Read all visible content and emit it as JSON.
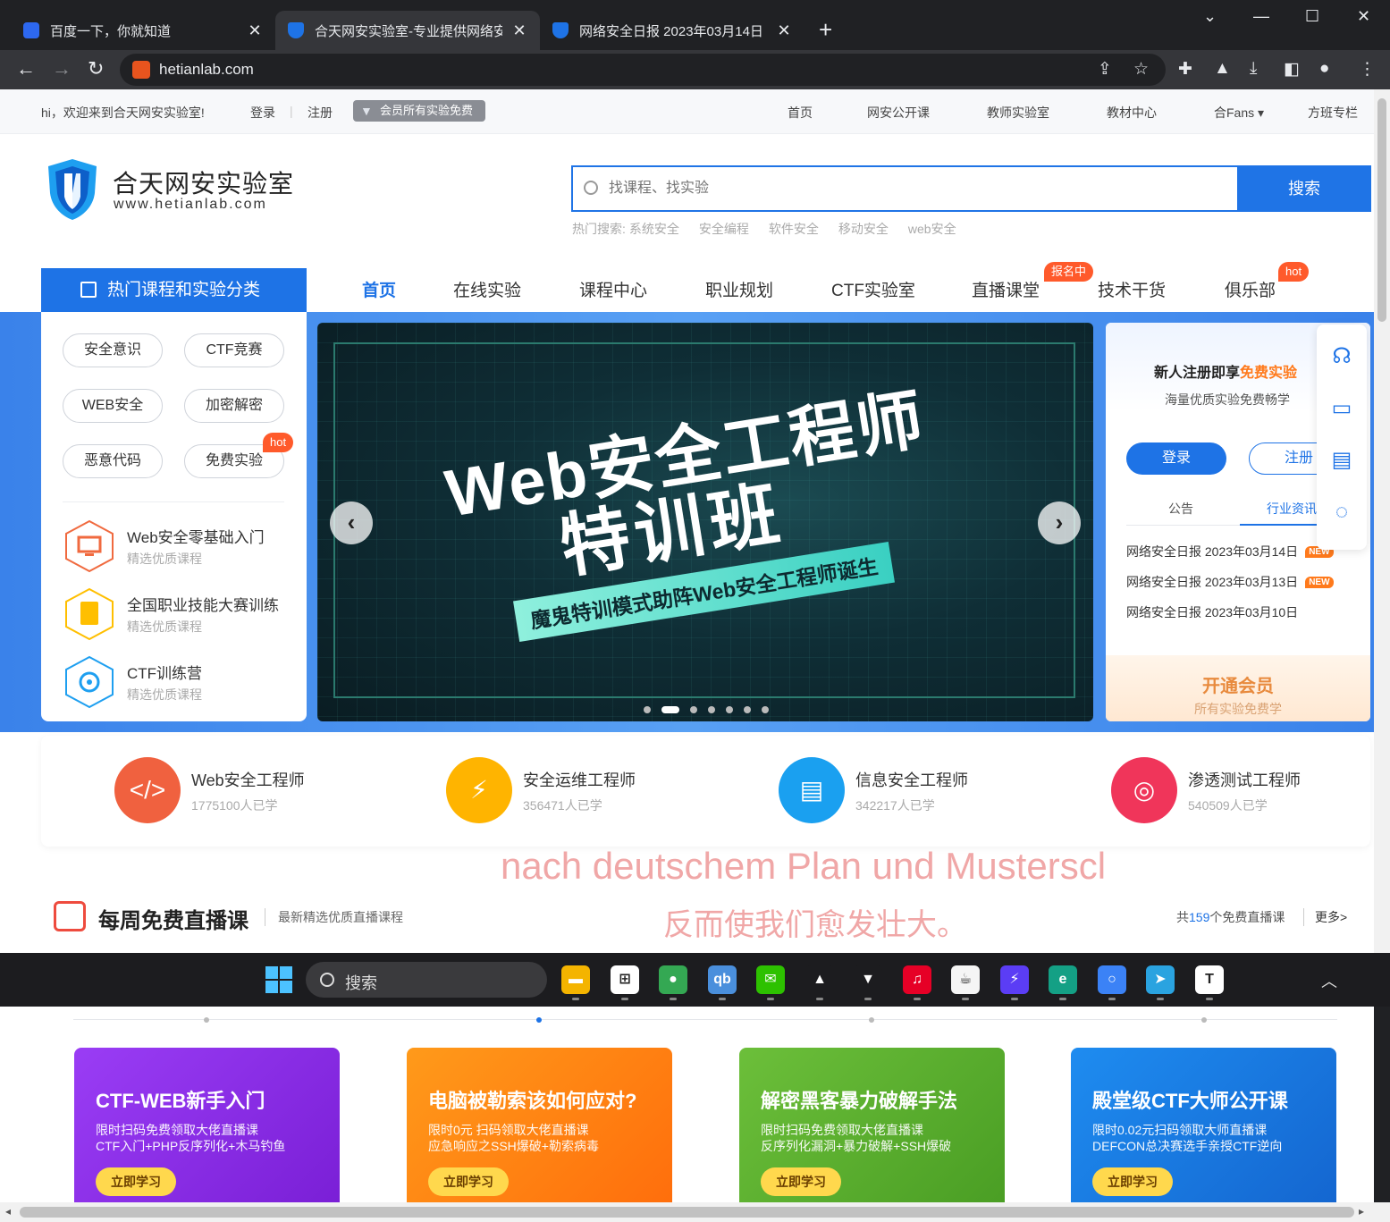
{
  "browser": {
    "tabs": [
      {
        "title": "百度一下，你就知道",
        "color": "#2d68f0"
      },
      {
        "title": "合天网安实验室-专业提供网络安",
        "color": "#1e73e6"
      },
      {
        "title": "网络安全日报 2023年03月14日 -",
        "color": "#1e73e6"
      }
    ],
    "new_tab": "+",
    "url": "hetianlab.com",
    "window": {
      "collapse": "⌄",
      "minimize": "—",
      "maximize": "☐",
      "close": "✕"
    }
  },
  "topbar": {
    "welcome": "hi，欢迎来到合天网安实验室!",
    "login": "登录",
    "separator": "|",
    "register": "注册",
    "vip_badge": "会员所有实验免费",
    "links": [
      "首页",
      "网安公开课",
      "教师实验室",
      "教材中心",
      "合Fans ▾",
      "方班专栏"
    ]
  },
  "logo": {
    "title": "合天网安实验室",
    "url": "www.hetianlab.com"
  },
  "search": {
    "placeholder": "找课程、找实验",
    "button": "搜索",
    "hot_label": "热门搜索:",
    "hot": [
      "系统安全",
      "安全编程",
      "软件安全",
      "移动安全",
      "web安全"
    ]
  },
  "category_header": "热门课程和实验分类",
  "main_nav": {
    "items": [
      "首页",
      "在线实验",
      "课程中心",
      "职业规划",
      "CTF实验室",
      "直播课堂",
      "技术干货",
      "俱乐部"
    ],
    "tag_live": "报名中",
    "tag_club": "hot"
  },
  "side": {
    "pills": [
      "安全意识",
      "CTF竞赛",
      "WEB安全",
      "加密解密",
      "恶意代码",
      "免费实验"
    ],
    "pill_hot": "hot",
    "courses": [
      {
        "title": "Web安全零基础入门",
        "sub": "精选优质课程"
      },
      {
        "title": "全国职业技能大赛训练",
        "sub": "精选优质课程"
      },
      {
        "title": "CTF训练营",
        "sub": "精选优质课程"
      }
    ]
  },
  "banner": {
    "line1": "Web安全工程师",
    "line2": "特训班",
    "sub": "魔鬼特训模式助阵Web安全工程师诞生",
    "prev": "‹",
    "next": "›",
    "slide_count": 7,
    "active_slide": 2
  },
  "login_panel": {
    "title_pre": "新人注册即享",
    "title_hl": "免费实验",
    "sub": "海量优质实验免费畅学",
    "login": "登录",
    "register": "注册",
    "tabs": [
      "公告",
      "行业资讯"
    ],
    "news": [
      {
        "text": "网络安全日报 2023年03月14日",
        "tag": "NEW"
      },
      {
        "text": "网络安全日报 2023年03月13日",
        "tag": "NEW"
      },
      {
        "text": "网络安全日报 2023年03月10日",
        "tag": ""
      }
    ],
    "vip_title": "开通会员",
    "vip_sub": "所有实验免费学"
  },
  "floating_icons": [
    "headset-icon",
    "wallet-icon",
    "document-icon",
    "chat-icon"
  ],
  "careers": [
    {
      "title": "Web安全工程师",
      "learners": "1775100人已学",
      "color": "#f0613f",
      "glyph": "</>"
    },
    {
      "title": "安全运维工程师",
      "learners": "356471人已学",
      "color": "#ffb400",
      "glyph": "⚡"
    },
    {
      "title": "信息安全工程师",
      "learners": "342217人已学",
      "color": "#1aa0f0",
      "glyph": "▤"
    },
    {
      "title": "渗透测试工程师",
      "learners": "540509人已学",
      "color": "#f0355a",
      "glyph": "◎"
    }
  ],
  "overlay_text": [
    "nach deutschem Plan und Musterscl",
    "反而使我们愈发壮大。"
  ],
  "live": {
    "title": "每周免费直播课",
    "sub": "最新精选优质直播课程",
    "count_pre": "共",
    "count": "159",
    "count_post": "个免费直播课",
    "more": "更多>"
  },
  "taskbar": {
    "search": "搜索",
    "apps": [
      {
        "name": "file-explorer-icon",
        "color": "#f4b400",
        "glyph": "▬"
      },
      {
        "name": "store-icon",
        "color": "#ffffff",
        "glyph": "⊞"
      },
      {
        "name": "chrome-dev-icon",
        "color": "#34a853",
        "glyph": "●"
      },
      {
        "name": "qbittorrent-icon",
        "color": "#4a8fdc",
        "glyph": "qb"
      },
      {
        "name": "wechat-icon",
        "color": "#2dc100",
        "glyph": "✉"
      },
      {
        "name": "cat-icon",
        "color": "#1c1c1f",
        "glyph": "▲"
      },
      {
        "name": "vpn-icon",
        "color": "#1c1c1f",
        "glyph": "▼"
      },
      {
        "name": "netease-music-icon",
        "color": "#e60026",
        "glyph": "♫"
      },
      {
        "name": "java-icon",
        "color": "#f5f5f5",
        "glyph": "☕"
      },
      {
        "name": "bolt-app-icon",
        "color": "#5b3df5",
        "glyph": "⚡"
      },
      {
        "name": "e-app-icon",
        "color": "#14a085",
        "glyph": "e"
      },
      {
        "name": "browser-icon",
        "color": "#3b82f6",
        "glyph": "○"
      },
      {
        "name": "telegram-icon",
        "color": "#2aa3e0",
        "glyph": "➤"
      },
      {
        "name": "typora-icon",
        "color": "#ffffff",
        "glyph": "T"
      }
    ],
    "tray_up": "︿"
  },
  "live_cards": [
    {
      "title": "CTF-WEB新手入门",
      "l1": "限时扫码免费领取大佬直播课",
      "l2": "CTF入门+PHP反序列化+木马钓鱼",
      "btn": "立即学习",
      "color": "#8a2be2"
    },
    {
      "title": "电脑被勒索该如何应对?",
      "l1": "限时0元 扫码领取大佬直播课",
      "l2": "应急响应之SSH爆破+勒索病毒",
      "btn": "立即学习",
      "color": "#ff7a12"
    },
    {
      "title": "解密黑客暴力破解手法",
      "l1": "限时扫码免费领取大佬直播课",
      "l2": "反序列化漏洞+暴力破解+SSH爆破",
      "btn": "立即学习",
      "color": "#5aa832"
    },
    {
      "title": "殿堂级CTF大师公开课",
      "l1": "限时0.02元扫码领取大师直播课",
      "l2": "DEFCON总决赛选手亲授CTF逆向",
      "btn": "立即学习",
      "color": "#1a7be0"
    }
  ]
}
